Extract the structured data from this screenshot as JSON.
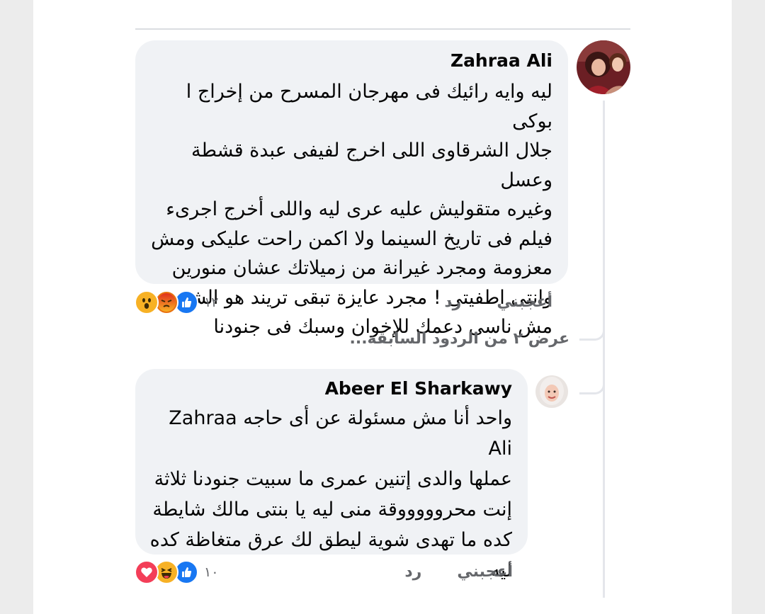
{
  "comments": [
    {
      "author": "Zahraa Ali",
      "text": "ليه وايه رائيك فى مهرجان المسرح من إخراج ا بوكى\nجلال الشرقاوى اللى اخرج لفيفى عبدة قشطة وعسل\nوغيره متقوليش عليه عرى ليه واللى أخرج اجرىء\nفيلم فى تاريخ السينما ولا اكمن راحت عليكى ومش\nمعزومة ومجرد غيرانة من زميلاتك  عشان منورين\nوانتى اطفيتى ! مجرد عايزة تبقى تريند هو الشعب\nمش ناسى دعمك للإخوان وسبك فى جنودنا",
      "like_label": "أعجبني",
      "reply_label": "رد",
      "reaction_count": "١٢",
      "reactions": [
        "like-icon",
        "angry-icon",
        "wow-icon"
      ]
    },
    {
      "author": "Abeer El Sharkawy",
      "text": "واحد أنا مش مسئولة عن أى حاجه Zahraa Ali\nعملها والدى إتنين عمرى ما سبيت جنودنا ثلاثة\nإنت محروووووقة منى ليه يا بنتى مالك شايطة\nكده ما تهدى شوية ليطق لك عرق متغاظة كده\nليه",
      "like_label": "أعجبني",
      "reply_label": "رد",
      "reaction_count": "١٠",
      "reactions": [
        "like-icon",
        "haha-icon",
        "love-icon"
      ]
    }
  ],
  "view_previous_replies": "عرض ٢ من الردود السابقة...",
  "colors": {
    "bubble": "#f0f2f5",
    "meta_text": "#65676b",
    "like_blue": "#1877f2",
    "love_red": "#f33e58",
    "emoji_yellow": "#f7b125",
    "angry_orange": "#e9710f"
  }
}
